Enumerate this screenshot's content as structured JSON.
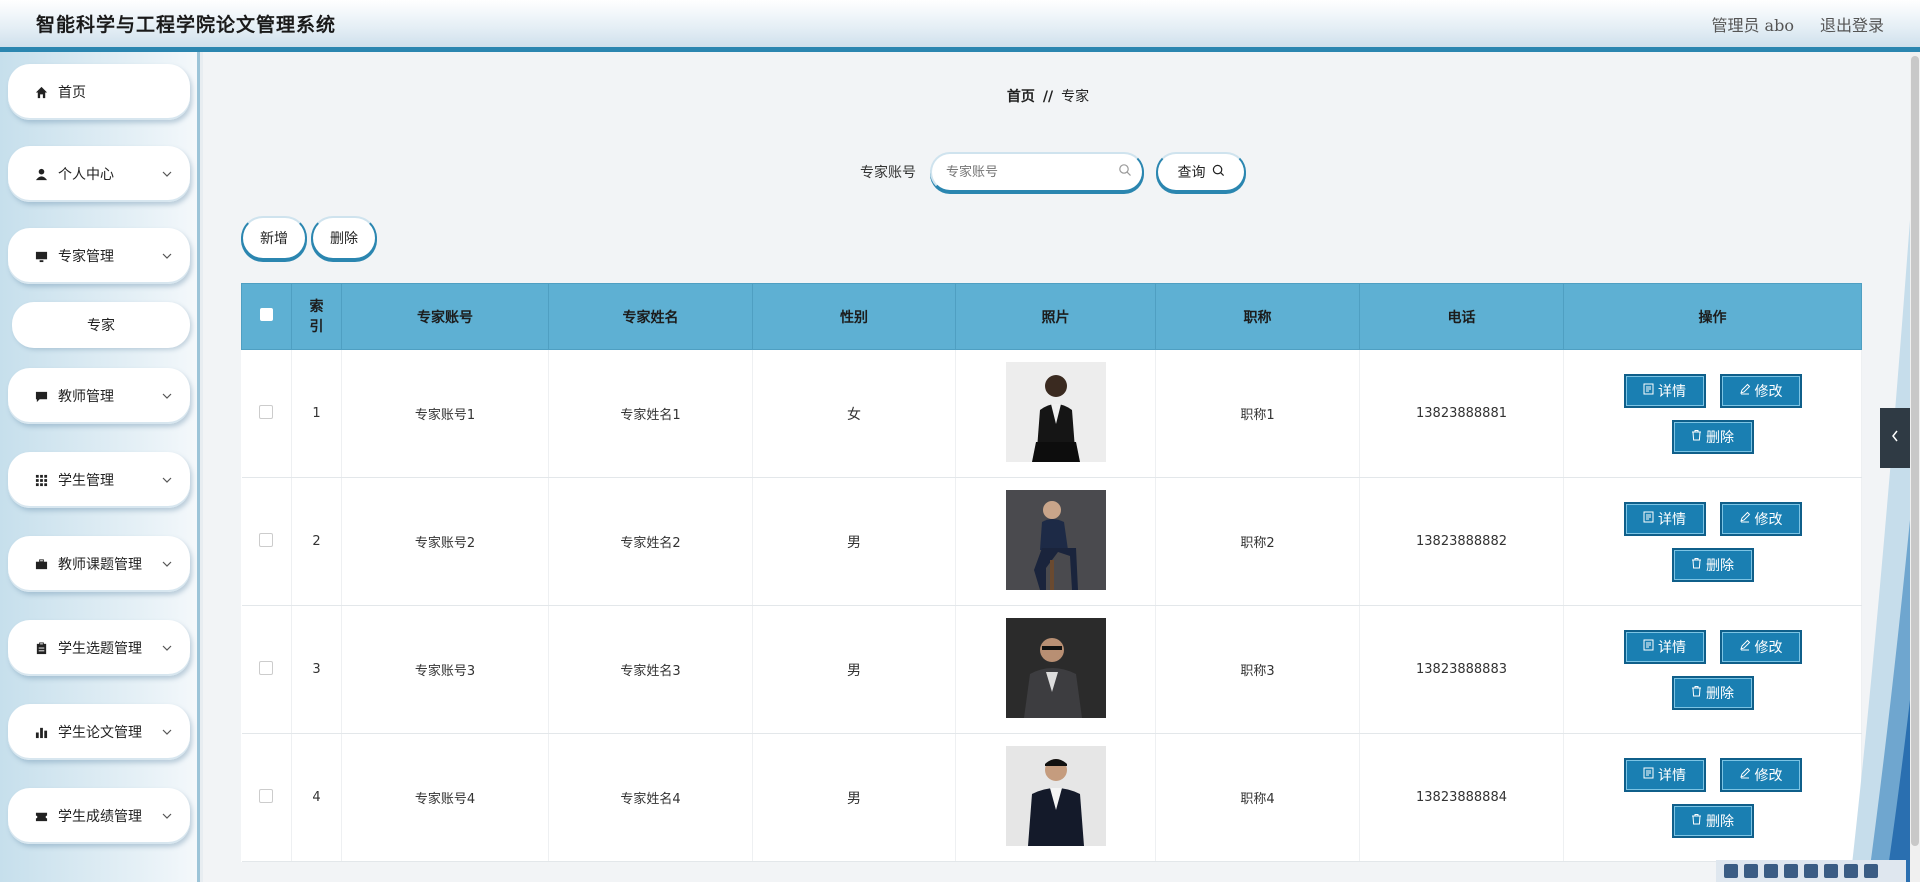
{
  "header": {
    "title": "智能科学与工程学院论文管理系统",
    "user": "管理员 abo",
    "logout": "退出登录"
  },
  "sidebar": {
    "items": [
      {
        "label": "首页",
        "icon": "home-icon",
        "has_chevron": false
      },
      {
        "label": "个人中心",
        "icon": "user-icon",
        "has_chevron": true
      },
      {
        "label": "专家管理",
        "icon": "monitor-icon",
        "has_chevron": true
      },
      {
        "label": "教师管理",
        "icon": "chat-icon",
        "has_chevron": true
      },
      {
        "label": "学生管理",
        "icon": "grid-icon",
        "has_chevron": true
      },
      {
        "label": "教师课题管理",
        "icon": "briefcase-icon",
        "has_chevron": true
      },
      {
        "label": "学生选题管理",
        "icon": "clipboard-icon",
        "has_chevron": true
      },
      {
        "label": "学生论文管理",
        "icon": "bar-chart-icon",
        "has_chevron": true
      },
      {
        "label": "学生成绩管理",
        "icon": "ticket-icon",
        "has_chevron": true
      }
    ],
    "subitem": "专家"
  },
  "breadcrumb": {
    "home": "首页",
    "sep": "//",
    "current": "专家"
  },
  "search": {
    "label": "专家账号",
    "placeholder": "专家账号",
    "button": "查询"
  },
  "actions": {
    "add": "新增",
    "delete": "删除"
  },
  "table": {
    "headers": [
      "",
      "索引",
      "专家账号",
      "专家姓名",
      "性别",
      "照片",
      "职称",
      "电话",
      "操作"
    ],
    "rows": [
      {
        "index": "1",
        "account": "专家账号1",
        "name": "专家姓名1",
        "gender": "女",
        "title": "职称1",
        "phone": "13823888881"
      },
      {
        "index": "2",
        "account": "专家账号2",
        "name": "专家姓名2",
        "gender": "男",
        "title": "职称2",
        "phone": "13823888882"
      },
      {
        "index": "3",
        "account": "专家账号3",
        "name": "专家姓名3",
        "gender": "男",
        "title": "职称3",
        "phone": "13823888883"
      },
      {
        "index": "4",
        "account": "专家账号4",
        "name": "专家姓名4",
        "gender": "男",
        "title": "职称4",
        "phone": "13823888884"
      }
    ],
    "ops": {
      "detail": "详情",
      "edit": "修改",
      "delete": "删除"
    }
  },
  "colors": {
    "accent": "#2b86b0",
    "header_row": "#5eb0d3",
    "op_button": "#1a7fb2"
  }
}
